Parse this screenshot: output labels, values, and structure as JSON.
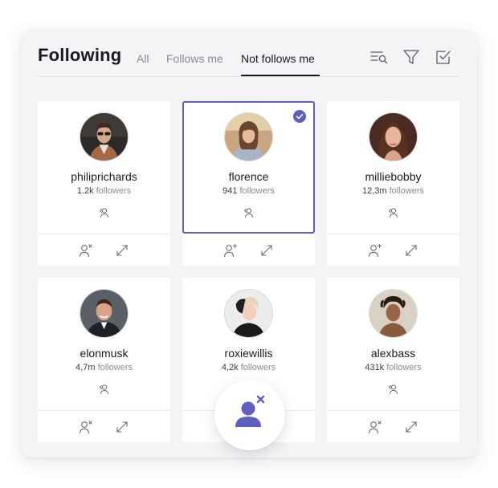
{
  "header": {
    "title": "Following",
    "tabs": [
      {
        "label": "All",
        "active": false
      },
      {
        "label": "Follows me",
        "active": false
      },
      {
        "label": "Not follows me",
        "active": true
      }
    ],
    "icons": [
      "search-list-icon",
      "filter-icon",
      "select-all-icon"
    ]
  },
  "cards": [
    {
      "username": "philiprichards",
      "count": "1.2k",
      "followers_label": "followers",
      "selected": false
    },
    {
      "username": "florence",
      "count": "941",
      "followers_label": "followers",
      "selected": true
    },
    {
      "username": "milliebobby",
      "count": "12,3m",
      "followers_label": "followers",
      "selected": false
    },
    {
      "username": "elonmusk",
      "count": "4,7m",
      "followers_label": "followers",
      "selected": false
    },
    {
      "username": "roxiewillis",
      "count": "4,2k",
      "followers_label": "followers",
      "selected": false
    },
    {
      "username": "alexbass",
      "count": "431k",
      "followers_label": "followers",
      "selected": false
    }
  ],
  "colors": {
    "accent": "#5e5fbe",
    "panel_bg": "#f4f4f6",
    "text_primary": "#1a1a22",
    "text_muted": "#8a8a94"
  },
  "fab": {
    "icon": "unfollow-user-icon"
  }
}
